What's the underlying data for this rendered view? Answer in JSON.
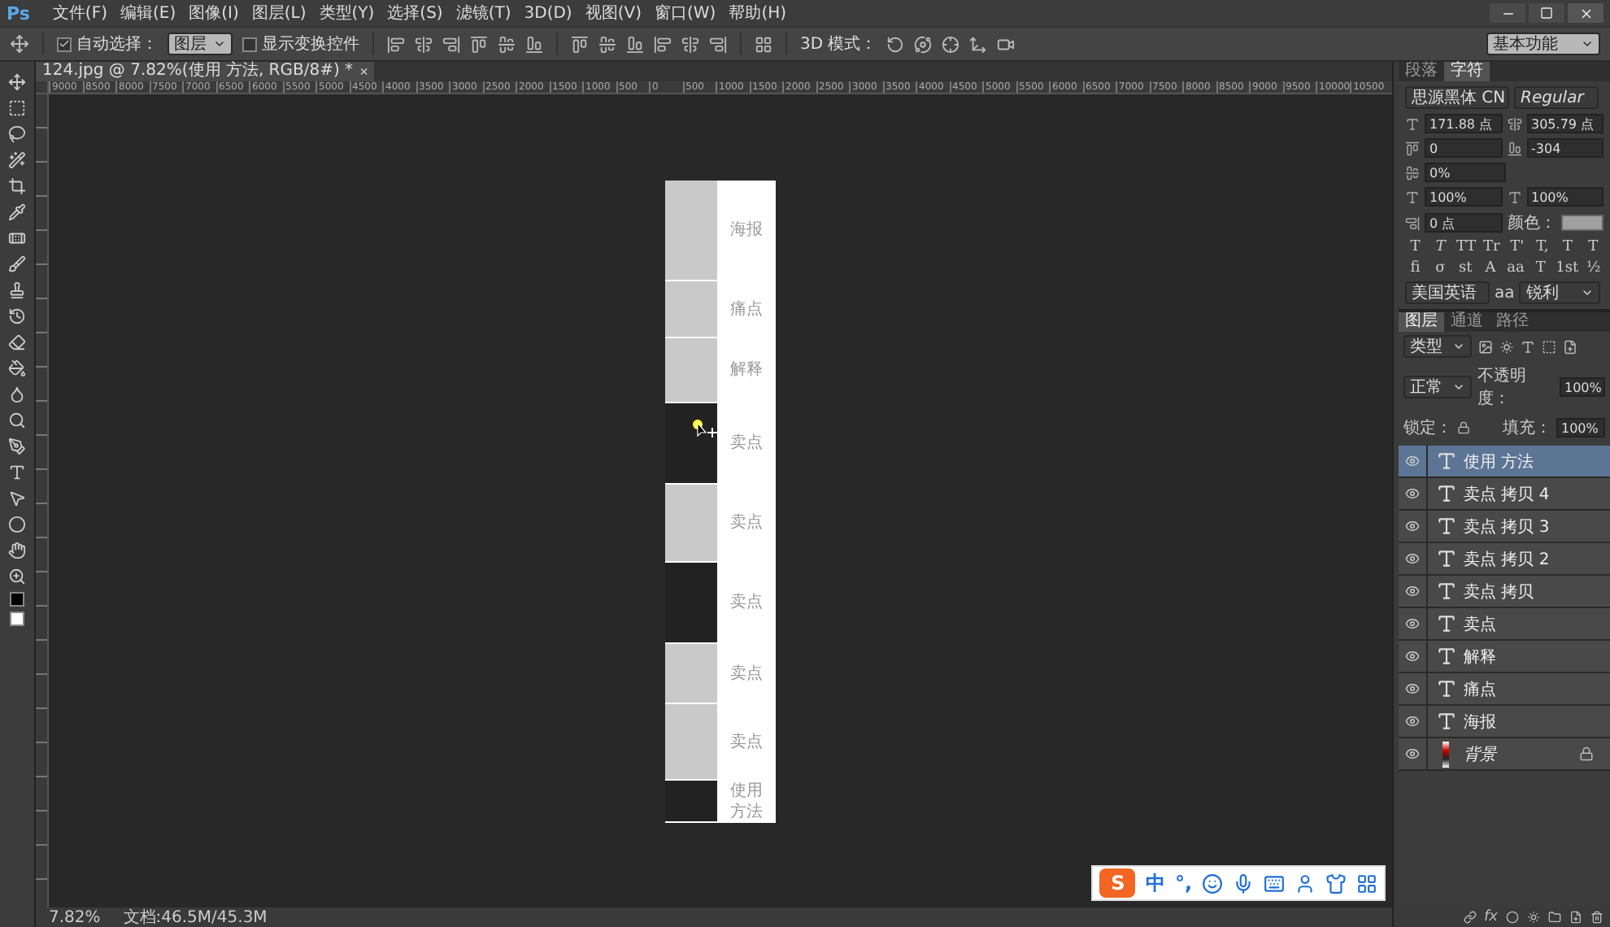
{
  "app": {
    "logo": "Ps",
    "menu": [
      "文件(F)",
      "编辑(E)",
      "图像(I)",
      "图层(L)",
      "类型(Y)",
      "选择(S)",
      "滤镜(T)",
      "3D(D)",
      "视图(V)",
      "窗口(W)",
      "帮助(H)"
    ]
  },
  "options_bar": {
    "auto_select": {
      "label": "自动选择：",
      "checked": true,
      "value": "图层"
    },
    "show_transform": {
      "label": "显示变换控件",
      "checked": false
    },
    "mode_3d_label": "3D 模式：",
    "workspace": "基本功能"
  },
  "document_tab": {
    "title": "124.jpg @ 7.82%(使用 方法, RGB/8#) *",
    "close": "×"
  },
  "ruler": {
    "labels": [
      "9000",
      "8500",
      "8000",
      "7500",
      "7000",
      "6500",
      "6000",
      "5500",
      "5000",
      "4500",
      "4000",
      "3500",
      "3000",
      "2500",
      "2000",
      "1500",
      "1000",
      "500",
      "0",
      "500",
      "1000",
      "1500",
      "2000",
      "2500",
      "3000",
      "3500",
      "4000",
      "4500",
      "5000",
      "5500",
      "6000",
      "6500",
      "7000",
      "7500",
      "8000",
      "8500",
      "9000",
      "9500",
      "10000",
      "10500"
    ]
  },
  "canvas": {
    "sections": [
      {
        "label": "海报"
      },
      {
        "label": "痛点"
      },
      {
        "label": "解释"
      },
      {
        "label": "卖点"
      },
      {
        "label": "卖点"
      },
      {
        "label": "卖点"
      },
      {
        "label": "卖点"
      },
      {
        "label": "卖点"
      },
      {
        "label": "使用方法"
      }
    ]
  },
  "character_panel": {
    "tabs": [
      {
        "label": "段落",
        "selected": false
      },
      {
        "label": "字符",
        "selected": true
      }
    ],
    "font_family": "思源黑体 CN",
    "font_style": "Regular",
    "size": "171.88 点",
    "leading": "305.79 点",
    "kerning": "0",
    "tracking": "-304",
    "tsume": "0%",
    "vertical_scale": "100%",
    "horizontal_scale": "100%",
    "baseline": "0 点",
    "color_label": "颜色：",
    "style_buttons": [
      "T",
      "T",
      "TT",
      "Tr",
      "T'",
      "T,",
      "T",
      "T"
    ],
    "feature_buttons": [
      "fi",
      "σ",
      "st",
      "A",
      "aa",
      "T",
      "1st",
      "½"
    ],
    "language": "美国英语",
    "aa_label": "aa",
    "antialias": "锐利"
  },
  "layers_panel": {
    "tabs": [
      {
        "label": "图层",
        "selected": true
      },
      {
        "label": "通道",
        "selected": false
      },
      {
        "label": "路径",
        "selected": false
      }
    ],
    "filter": "类型",
    "blend_mode": "正常",
    "opacity_label": "不透明度：",
    "opacity": "100%",
    "lock_label": "锁定：",
    "fill_label": "填充：",
    "fill": "100%",
    "layers": [
      {
        "name": "使用 方法",
        "kind": "text",
        "selected": true,
        "visible": true
      },
      {
        "name": "卖点 拷贝 4",
        "kind": "text",
        "selected": false,
        "visible": true
      },
      {
        "name": "卖点 拷贝 3",
        "kind": "text",
        "selected": false,
        "visible": true
      },
      {
        "name": "卖点 拷贝 2",
        "kind": "text",
        "selected": false,
        "visible": true
      },
      {
        "name": "卖点 拷贝",
        "kind": "text",
        "selected": false,
        "visible": true
      },
      {
        "name": "卖点",
        "kind": "text",
        "selected": false,
        "visible": true
      },
      {
        "name": "解释",
        "kind": "text",
        "selected": false,
        "visible": true
      },
      {
        "name": "痛点",
        "kind": "text",
        "selected": false,
        "visible": true
      },
      {
        "name": "海报",
        "kind": "text",
        "selected": false,
        "visible": true
      },
      {
        "name": "背景",
        "kind": "image",
        "selected": false,
        "visible": true,
        "locked": true
      }
    ],
    "footer_fx": "fx"
  },
  "status_bar": {
    "zoom": "7.82%",
    "doc_size": "文档:46.5M/45.3M"
  },
  "ime_bar": {
    "logo": "S",
    "mode": "中",
    "punctuation": "°,"
  }
}
